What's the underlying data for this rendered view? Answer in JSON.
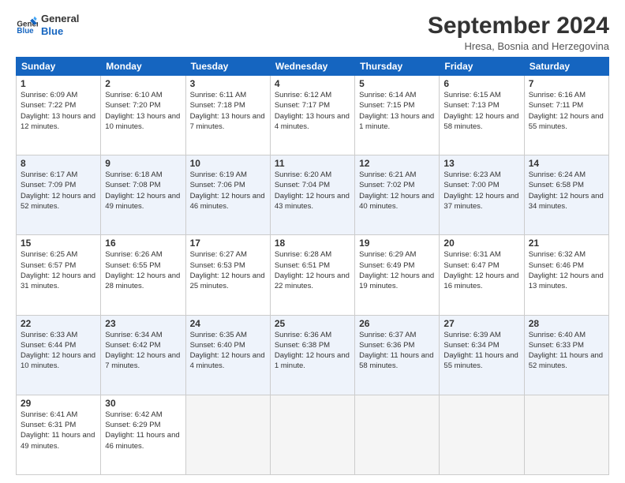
{
  "logo": {
    "line1": "General",
    "line2": "Blue"
  },
  "title": "September 2024",
  "subtitle": "Hresa, Bosnia and Herzegovina",
  "days_of_week": [
    "Sunday",
    "Monday",
    "Tuesday",
    "Wednesday",
    "Thursday",
    "Friday",
    "Saturday"
  ],
  "weeks": [
    [
      {
        "day": "1",
        "info": "Sunrise: 6:09 AM\nSunset: 7:22 PM\nDaylight: 13 hours and 12 minutes."
      },
      {
        "day": "2",
        "info": "Sunrise: 6:10 AM\nSunset: 7:20 PM\nDaylight: 13 hours and 10 minutes."
      },
      {
        "day": "3",
        "info": "Sunrise: 6:11 AM\nSunset: 7:18 PM\nDaylight: 13 hours and 7 minutes."
      },
      {
        "day": "4",
        "info": "Sunrise: 6:12 AM\nSunset: 7:17 PM\nDaylight: 13 hours and 4 minutes."
      },
      {
        "day": "5",
        "info": "Sunrise: 6:14 AM\nSunset: 7:15 PM\nDaylight: 13 hours and 1 minute."
      },
      {
        "day": "6",
        "info": "Sunrise: 6:15 AM\nSunset: 7:13 PM\nDaylight: 12 hours and 58 minutes."
      },
      {
        "day": "7",
        "info": "Sunrise: 6:16 AM\nSunset: 7:11 PM\nDaylight: 12 hours and 55 minutes."
      }
    ],
    [
      {
        "day": "8",
        "info": "Sunrise: 6:17 AM\nSunset: 7:09 PM\nDaylight: 12 hours and 52 minutes."
      },
      {
        "day": "9",
        "info": "Sunrise: 6:18 AM\nSunset: 7:08 PM\nDaylight: 12 hours and 49 minutes."
      },
      {
        "day": "10",
        "info": "Sunrise: 6:19 AM\nSunset: 7:06 PM\nDaylight: 12 hours and 46 minutes."
      },
      {
        "day": "11",
        "info": "Sunrise: 6:20 AM\nSunset: 7:04 PM\nDaylight: 12 hours and 43 minutes."
      },
      {
        "day": "12",
        "info": "Sunrise: 6:21 AM\nSunset: 7:02 PM\nDaylight: 12 hours and 40 minutes."
      },
      {
        "day": "13",
        "info": "Sunrise: 6:23 AM\nSunset: 7:00 PM\nDaylight: 12 hours and 37 minutes."
      },
      {
        "day": "14",
        "info": "Sunrise: 6:24 AM\nSunset: 6:58 PM\nDaylight: 12 hours and 34 minutes."
      }
    ],
    [
      {
        "day": "15",
        "info": "Sunrise: 6:25 AM\nSunset: 6:57 PM\nDaylight: 12 hours and 31 minutes."
      },
      {
        "day": "16",
        "info": "Sunrise: 6:26 AM\nSunset: 6:55 PM\nDaylight: 12 hours and 28 minutes."
      },
      {
        "day": "17",
        "info": "Sunrise: 6:27 AM\nSunset: 6:53 PM\nDaylight: 12 hours and 25 minutes."
      },
      {
        "day": "18",
        "info": "Sunrise: 6:28 AM\nSunset: 6:51 PM\nDaylight: 12 hours and 22 minutes."
      },
      {
        "day": "19",
        "info": "Sunrise: 6:29 AM\nSunset: 6:49 PM\nDaylight: 12 hours and 19 minutes."
      },
      {
        "day": "20",
        "info": "Sunrise: 6:31 AM\nSunset: 6:47 PM\nDaylight: 12 hours and 16 minutes."
      },
      {
        "day": "21",
        "info": "Sunrise: 6:32 AM\nSunset: 6:46 PM\nDaylight: 12 hours and 13 minutes."
      }
    ],
    [
      {
        "day": "22",
        "info": "Sunrise: 6:33 AM\nSunset: 6:44 PM\nDaylight: 12 hours and 10 minutes."
      },
      {
        "day": "23",
        "info": "Sunrise: 6:34 AM\nSunset: 6:42 PM\nDaylight: 12 hours and 7 minutes."
      },
      {
        "day": "24",
        "info": "Sunrise: 6:35 AM\nSunset: 6:40 PM\nDaylight: 12 hours and 4 minutes."
      },
      {
        "day": "25",
        "info": "Sunrise: 6:36 AM\nSunset: 6:38 PM\nDaylight: 12 hours and 1 minute."
      },
      {
        "day": "26",
        "info": "Sunrise: 6:37 AM\nSunset: 6:36 PM\nDaylight: 11 hours and 58 minutes."
      },
      {
        "day": "27",
        "info": "Sunrise: 6:39 AM\nSunset: 6:34 PM\nDaylight: 11 hours and 55 minutes."
      },
      {
        "day": "28",
        "info": "Sunrise: 6:40 AM\nSunset: 6:33 PM\nDaylight: 11 hours and 52 minutes."
      }
    ],
    [
      {
        "day": "29",
        "info": "Sunrise: 6:41 AM\nSunset: 6:31 PM\nDaylight: 11 hours and 49 minutes."
      },
      {
        "day": "30",
        "info": "Sunrise: 6:42 AM\nSunset: 6:29 PM\nDaylight: 11 hours and 46 minutes."
      },
      null,
      null,
      null,
      null,
      null
    ]
  ]
}
